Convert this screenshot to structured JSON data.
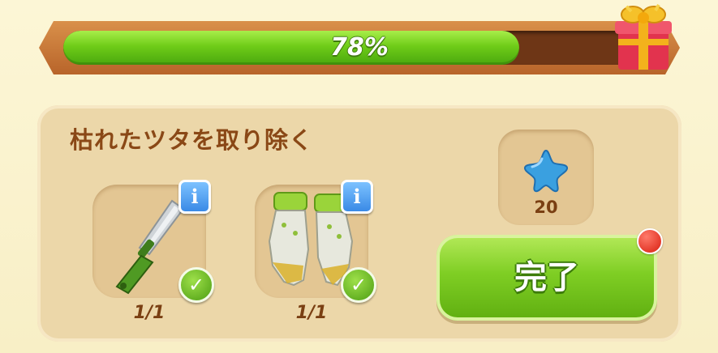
{
  "progress": {
    "percent_label": "78%",
    "fraction": 0.78
  },
  "quest": {
    "title": "枯れたツタを取り除く"
  },
  "requirements": [
    {
      "item": "knife-icon",
      "count": "1/1",
      "info_label": "i",
      "completed": true
    },
    {
      "item": "gloves-icon",
      "count": "1/1",
      "info_label": "i",
      "completed": true
    }
  ],
  "reward": {
    "icon": "blue-star-icon",
    "amount": "20"
  },
  "complete_button": {
    "label": "完了",
    "has_notification": true
  },
  "colors": {
    "progress_green": "#6fcc18",
    "frame_brown": "#b8642a",
    "title_brown": "#8a4816",
    "button_green": "#7fce24",
    "info_blue": "#3a8ae6",
    "notification_red": "#d81e10",
    "reward_blue": "#3aa0e0"
  }
}
